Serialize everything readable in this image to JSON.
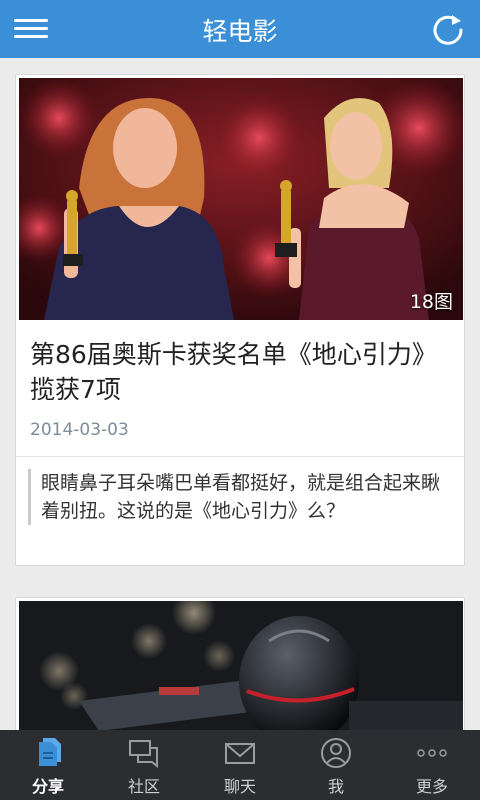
{
  "header": {
    "title": "轻电影",
    "menu_icon": "hamburger-menu-icon",
    "refresh_icon": "refresh-icon"
  },
  "feed": {
    "articles": [
      {
        "photo_count": "18图",
        "title": "第86届奥斯卡获奖名单《地心引力》揽获7项",
        "date": "2014-03-03",
        "quote": "眼睛鼻子耳朵嘴巴单看都挺好，就是组合起来瞅着别扭。这说的是《地心引力》么？"
      }
    ]
  },
  "tabbar": {
    "tabs": [
      {
        "label": "分享",
        "icon": "share-document-icon",
        "active": true
      },
      {
        "label": "社区",
        "icon": "community-chat-icon",
        "active": false
      },
      {
        "label": "聊天",
        "icon": "envelope-icon",
        "active": false
      },
      {
        "label": "我",
        "icon": "user-profile-icon",
        "active": false
      },
      {
        "label": "更多",
        "icon": "more-dots-icon",
        "active": false
      }
    ]
  },
  "colors": {
    "header_bg": "#3a8fd6",
    "tabbar_bg": "#2b2d31",
    "active_icon": "#3a8fd6",
    "date_text": "#7d8c99"
  }
}
